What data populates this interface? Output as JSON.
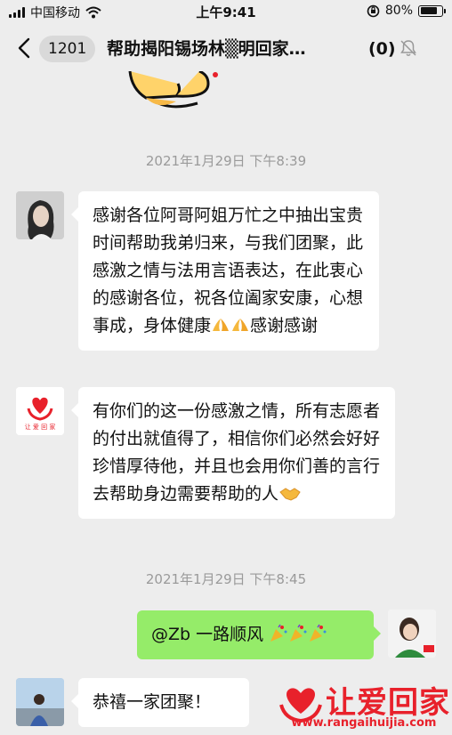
{
  "status_bar": {
    "carrier": "中国移动",
    "time": "上午9:41",
    "battery": "80%",
    "battery_level": 0.8
  },
  "nav": {
    "back_count": "1201",
    "title": "帮助揭阳锡场林▒明回家…",
    "member_count": "(0)"
  },
  "messages": {
    "ts1": "2021年1月29日 下午8:39",
    "m1_text": "感谢各位阿哥阿姐万忙之中抽出宝贵时间帮助我弟归来，与我们团聚，此感激之情与法用言语表达，在此衷心的感谢各位，祝各位阖家安康，心想事成，身体健康",
    "m1_tail": "感谢感谢",
    "m2_avatar_caption": "让 爱 回 家",
    "m2_text": "有你们的这一份感激之情，所有志愿者的付出就值得了，相信你们必然会好好珍惜厚待他，并且也会用你们善的言行去帮助身边需要帮助的人",
    "ts2": "2021年1月29日 下午8:45",
    "m3_text": "@Zb 一路顺风",
    "m4_text": "恭禧一家团聚！"
  },
  "watermark": {
    "brand": "让爱回家",
    "url": "www.rangaihuijia.com"
  },
  "colors": {
    "sent_bubble": "#95ec69",
    "received_bubble": "#ffffff",
    "background": "#ededed",
    "brand_red": "#e8212b"
  }
}
